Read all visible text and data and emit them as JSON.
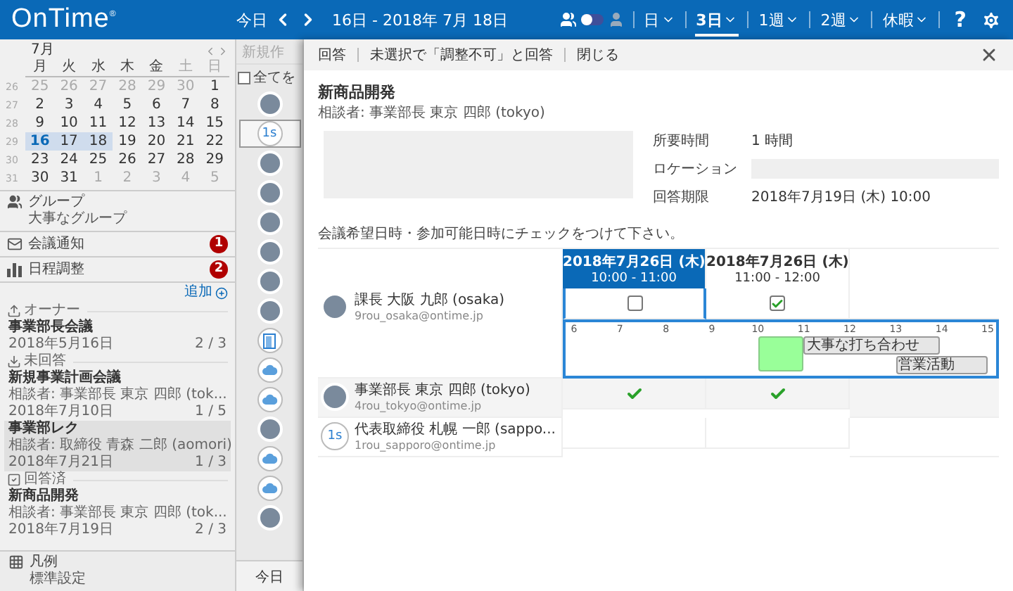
{
  "topbar": {
    "logo": "OnTime$^{®}$",
    "today": "今日",
    "range": "16日 - 2018年 7月 18日",
    "person_toggle": {
      "on": false
    },
    "views": [
      {
        "label": "日",
        "selected": false
      },
      {
        "label": "3日",
        "selected": true
      },
      {
        "label": "1週",
        "selected": false
      },
      {
        "label": "2週",
        "selected": false
      },
      {
        "label": "休暇",
        "selected": false
      }
    ],
    "help": "?"
  },
  "calendar": {
    "month": "7月",
    "weekdays": [
      {
        "label": "月",
        "kind": "weekday"
      },
      {
        "label": "火",
        "kind": "weekday"
      },
      {
        "label": "水",
        "kind": "weekday"
      },
      {
        "label": "木",
        "kind": "weekday"
      },
      {
        "label": "金",
        "kind": "weekday"
      },
      {
        "label": "土",
        "kind": "weekend"
      },
      {
        "label": "日",
        "kind": "weekend"
      }
    ],
    "weeks": [
      {
        "number": "26",
        "days": [
          {
            "label": "25",
            "muted": true,
            "selected": false,
            "today": false
          },
          {
            "label": "26",
            "muted": true,
            "selected": false,
            "today": false
          },
          {
            "label": "27",
            "muted": true,
            "selected": false,
            "today": false
          },
          {
            "label": "28",
            "muted": true,
            "selected": false,
            "today": false
          },
          {
            "label": "29",
            "muted": true,
            "selected": false,
            "today": false
          },
          {
            "label": "30",
            "muted": true,
            "selected": false,
            "today": false
          },
          {
            "label": "1",
            "muted": false,
            "selected": false,
            "today": false
          }
        ]
      },
      {
        "number": "27",
        "days": [
          {
            "label": "2",
            "muted": false,
            "selected": false,
            "today": false
          },
          {
            "label": "3",
            "muted": false,
            "selected": false,
            "today": false
          },
          {
            "label": "4",
            "muted": false,
            "selected": false,
            "today": false
          },
          {
            "label": "5",
            "muted": false,
            "selected": false,
            "today": false
          },
          {
            "label": "6",
            "muted": false,
            "selected": false,
            "today": false
          },
          {
            "label": "7",
            "muted": false,
            "selected": false,
            "today": false
          },
          {
            "label": "8",
            "muted": false,
            "selected": false,
            "today": false
          }
        ]
      },
      {
        "number": "28",
        "days": [
          {
            "label": "9",
            "muted": false,
            "selected": false,
            "today": false
          },
          {
            "label": "10",
            "muted": false,
            "selected": false,
            "today": false
          },
          {
            "label": "11",
            "muted": false,
            "selected": false,
            "today": false
          },
          {
            "label": "12",
            "muted": false,
            "selected": false,
            "today": false
          },
          {
            "label": "13",
            "muted": false,
            "selected": false,
            "today": false
          },
          {
            "label": "14",
            "muted": false,
            "selected": false,
            "today": false
          },
          {
            "label": "15",
            "muted": false,
            "selected": false,
            "today": false
          }
        ]
      },
      {
        "number": "29",
        "days": [
          {
            "label": "16",
            "muted": false,
            "selected": true,
            "today": true
          },
          {
            "label": "17",
            "muted": false,
            "selected": true,
            "today": false
          },
          {
            "label": "18",
            "muted": false,
            "selected": true,
            "today": false
          },
          {
            "label": "19",
            "muted": false,
            "selected": false,
            "today": false
          },
          {
            "label": "20",
            "muted": false,
            "selected": false,
            "today": false
          },
          {
            "label": "21",
            "muted": false,
            "selected": false,
            "today": false
          },
          {
            "label": "22",
            "muted": false,
            "selected": false,
            "today": false
          }
        ]
      },
      {
        "number": "30",
        "days": [
          {
            "label": "23",
            "muted": false,
            "selected": false,
            "today": false
          },
          {
            "label": "24",
            "muted": false,
            "selected": false,
            "today": false
          },
          {
            "label": "25",
            "muted": false,
            "selected": false,
            "today": false
          },
          {
            "label": "26",
            "muted": false,
            "selected": false,
            "today": false
          },
          {
            "label": "27",
            "muted": false,
            "selected": false,
            "today": false
          },
          {
            "label": "28",
            "muted": false,
            "selected": false,
            "today": false
          },
          {
            "label": "29",
            "muted": false,
            "selected": false,
            "today": false
          }
        ]
      },
      {
        "number": "31",
        "days": [
          {
            "label": "30",
            "muted": false,
            "selected": false,
            "today": false
          },
          {
            "label": "31",
            "muted": false,
            "selected": false,
            "today": false
          },
          {
            "label": "1",
            "muted": true,
            "selected": false,
            "today": false
          },
          {
            "label": "2",
            "muted": true,
            "selected": false,
            "today": false
          },
          {
            "label": "3",
            "muted": true,
            "selected": false,
            "today": false
          },
          {
            "label": "4",
            "muted": true,
            "selected": false,
            "today": false
          },
          {
            "label": "5",
            "muted": true,
            "selected": false,
            "today": false
          }
        ]
      }
    ]
  },
  "sidebar": {
    "group": {
      "title": "グループ",
      "subtitle": "大事なグループ"
    },
    "nav": [
      {
        "label": "会議通知",
        "badge": "1",
        "kind": "notice"
      },
      {
        "label": "日程調整",
        "badge": "2",
        "kind": "schedule"
      }
    ],
    "add": "追加",
    "sections": [
      {
        "label": "オーナー",
        "kind": "owner",
        "items": [
          {
            "title": "事業部長会議",
            "date": "2018年5月16日",
            "count": "2 / 3",
            "selected": false
          }
        ]
      },
      {
        "label": "未回答",
        "kind": "pending",
        "items": [
          {
            "title": "新規事業計画会議",
            "consultant": "相談者: 事業部長 東京 四郎 (tok...",
            "date": "2018年7月10日",
            "count": "1 / 5",
            "selected": false
          },
          {
            "title": "事業部レク",
            "consultant": "相談者: 取締役 青森 二郎 (aomori)",
            "date": "2018年7月21日",
            "count": "1 / 3",
            "selected": true
          }
        ]
      },
      {
        "label": "回答済",
        "kind": "answered",
        "items": [
          {
            "title": "新商品開発",
            "consultant": "相談者: 事業部長 東京 四郎 (tok...",
            "date": "2018年7月19日",
            "count": "2 / 3",
            "selected": false
          }
        ]
      }
    ],
    "footer": {
      "title": "凡例",
      "subtitle": "標準設定"
    }
  },
  "strip": {
    "header": "新規作",
    "select_all": {
      "label": "全てを",
      "checked": false
    },
    "today": "今日",
    "rows": [
      {
        "kind": "photo",
        "selected": false
      },
      {
        "kind": "initials",
        "text": "1s",
        "selected": true
      },
      {
        "kind": "photo",
        "selected": false
      },
      {
        "kind": "photo",
        "selected": false
      },
      {
        "kind": "photo",
        "selected": false
      },
      {
        "kind": "photo",
        "selected": false
      },
      {
        "kind": "photo",
        "selected": false
      },
      {
        "kind": "photo",
        "selected": false
      },
      {
        "kind": "door",
        "selected": false
      },
      {
        "kind": "cloud",
        "selected": false
      },
      {
        "kind": "cloud",
        "selected": false
      },
      {
        "kind": "photo",
        "selected": false
      },
      {
        "kind": "cloud",
        "selected": false
      },
      {
        "kind": "cloud",
        "selected": false
      },
      {
        "kind": "photo",
        "selected": false
      }
    ]
  },
  "dialog": {
    "actions": [
      "回答",
      "未選択で「調整不可」と回答",
      "閉じる"
    ],
    "title": "新商品開発",
    "consultant": "相談者: 事業部長 東京 四郎 (tokyo)",
    "info": [
      {
        "label": "所要時間",
        "kind": "text",
        "value": "1 時間"
      },
      {
        "label": "ロケーション",
        "kind": "field"
      },
      {
        "label": "回答期限",
        "kind": "text",
        "value": "2018年7月19日 (木)  10:00"
      }
    ],
    "instruction": "会議希望日時・参加可能日時にチェックをつけて下さい。",
    "slots": [
      {
        "date": "2018年7月26日 (木)",
        "time": "10:00 - 11:00",
        "selected": true
      },
      {
        "date": "2018年7月26日 (木)",
        "time": "11:00 - 12:00",
        "selected": false
      }
    ],
    "participants": [
      {
        "name": "課長 大阪 九郎 (osaka)",
        "email": "9rou_osaka@ontime.jp",
        "kind": "photo",
        "responses": [
          {
            "kind": "checkbox",
            "checked": false
          },
          {
            "kind": "checkbox",
            "checked": true
          }
        ],
        "timeline": {
          "hours": [
            "6",
            "7",
            "8",
            "9",
            "10",
            "11",
            "12",
            "13",
            "14",
            "15"
          ],
          "events": [
            {
              "kind": "slot"
            },
            {
              "kind": "busy",
              "label": "大事な打ち合わせ"
            },
            {
              "kind": "busy",
              "label": "営業活動"
            }
          ]
        }
      },
      {
        "name": "事業部長 東京 四郎 (tokyo)",
        "email": "4rou_tokyo@ontime.jp",
        "kind": "photo",
        "responses": [
          {
            "kind": "answer",
            "ok": true
          },
          {
            "kind": "answer",
            "ok": true
          }
        ]
      },
      {
        "name": "代表取締役 札幌 一郎 (sappo...",
        "email": "1rou_sapporo@ontime.jp",
        "kind": "initials",
        "initials": "1s",
        "responses": [
          {
            "kind": "answer",
            "ok": false
          },
          {
            "kind": "answer",
            "ok": false
          }
        ]
      }
    ]
  }
}
